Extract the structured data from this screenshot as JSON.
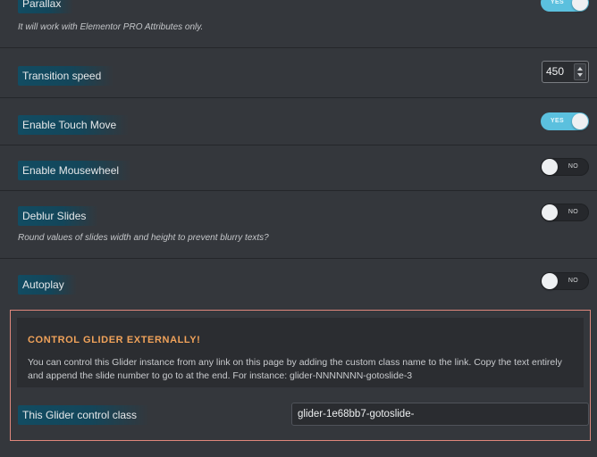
{
  "settings": {
    "parallax": {
      "label": "Parallax",
      "description": "It will work with Elementor PRO Attributes only.",
      "toggle_text": "YES",
      "enabled": true
    },
    "transition_speed": {
      "label": "Transition speed",
      "value": "450"
    },
    "touch_move": {
      "label": "Enable Touch Move",
      "toggle_text": "YES",
      "enabled": true
    },
    "mousewheel": {
      "label": "Enable Mousewheel",
      "toggle_text": "NO",
      "enabled": false
    },
    "deblur": {
      "label": "Deblur Slides",
      "description": "Round values of slides width and height to prevent blurry texts?",
      "toggle_text": "NO",
      "enabled": false
    },
    "autoplay": {
      "label": "Autoplay",
      "toggle_text": "NO",
      "enabled": false
    }
  },
  "external_control": {
    "title": "CONTROL GLIDER EXTERNALLY!",
    "text": "You can control this Glider instance from any link on this page by adding the custom class name to the link. Copy the text entirely and append the slide number to go to at the end. For instance: glider-NNNNNNN-gotoslide-3",
    "class_label": "This Glider control class",
    "class_value": "glider-1e68bb7-gotoslide-"
  },
  "colors": {
    "background": "#34373c",
    "toggle_on": "#5bc0de",
    "toggle_off": "#26282c",
    "label_highlight": "#124c62",
    "notice_title": "#f0a25a",
    "section_border": "#e0877c"
  }
}
